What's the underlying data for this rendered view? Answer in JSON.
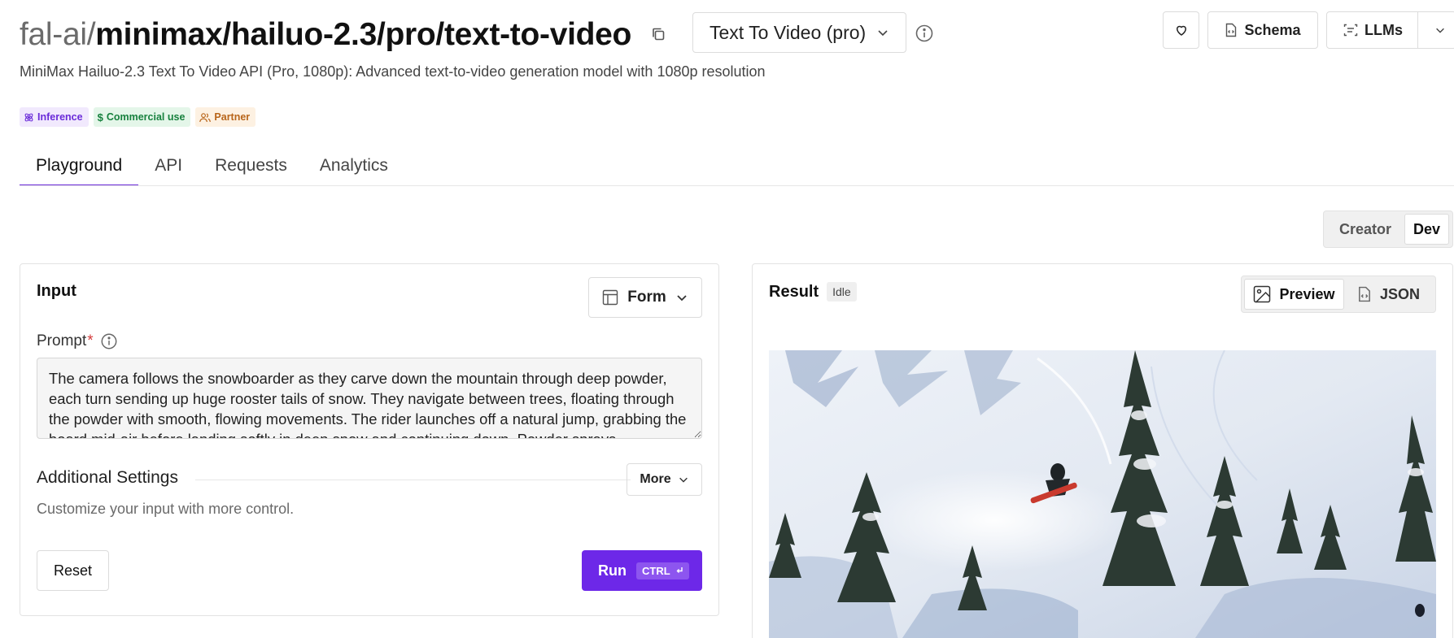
{
  "header": {
    "namespace": "fal-ai/",
    "model_path": "minimax/hailuo-2.3/pro/text-to-video",
    "variant": "Text To Video (pro)",
    "favorite_icon": "heart-icon",
    "schema_label": "Schema",
    "llms_label": "LLMs"
  },
  "subtitle": "MiniMax Hailuo-2.3 Text To Video API (Pro, 1080p): Advanced text-to-video generation model with 1080p resolution",
  "badges": [
    {
      "label": "Inference",
      "color": "#6a2bd9"
    },
    {
      "label": "Commercial use",
      "color": "#17813e"
    },
    {
      "label": "Partner",
      "color": "#b8651a"
    }
  ],
  "tabs": [
    {
      "label": "Playground",
      "active": true
    },
    {
      "label": "API"
    },
    {
      "label": "Requests"
    },
    {
      "label": "Analytics"
    }
  ],
  "mode_toggle": {
    "creator": "Creator",
    "dev": "Dev",
    "selected": "Dev"
  },
  "input": {
    "title": "Input",
    "form_selector": "Form",
    "prompt_label": "Prompt",
    "prompt_required_mark": "*",
    "prompt_value": "The camera follows the snowboarder as they carve down the mountain through deep powder, each turn sending up huge rooster tails of snow. They navigate between trees, floating through the powder with smooth, flowing movements. The rider launches off a natural jump, grabbing the board mid-air before landing softly in deep snow and continuing down. Powder sprays",
    "additional_settings_title": "Additional Settings",
    "more_label": "More",
    "additional_settings_help": "Customize your input with more control.",
    "reset_label": "Reset",
    "run_label": "Run",
    "run_shortcut": "CTRL"
  },
  "result": {
    "title": "Result",
    "status": "Idle",
    "preview_label": "Preview",
    "json_label": "JSON",
    "selected_view": "Preview"
  },
  "colors": {
    "accent": "#6d28e8"
  }
}
